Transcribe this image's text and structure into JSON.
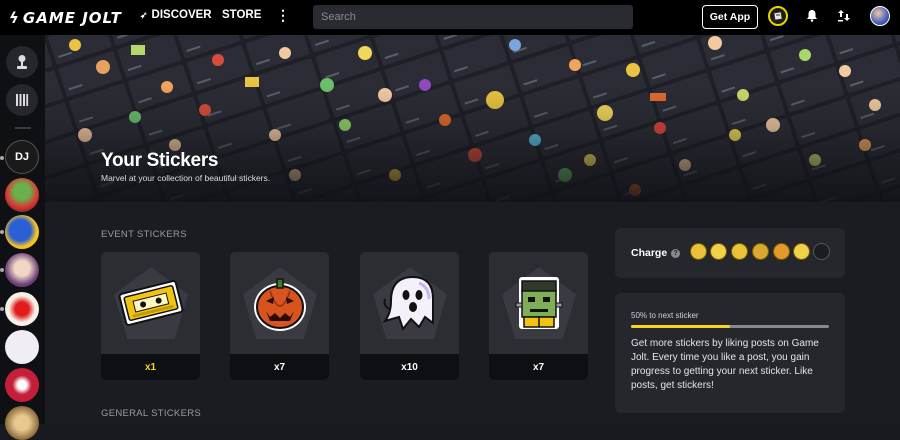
{
  "topbar": {
    "logo_text": "GAME JOLT",
    "nav_discover": "DISCOVER",
    "nav_store": "STORE",
    "more_label": "⋮",
    "search_placeholder": "Search",
    "get_app": "Get App"
  },
  "sidebar": {
    "communities": [
      "DJ",
      "",
      "",
      "",
      "",
      "",
      "",
      ""
    ]
  },
  "banner": {
    "title": "Your Stickers",
    "subtitle": "Marvel at your collection of beautiful stickers."
  },
  "event_stickers": {
    "label": "EVENT STICKERS",
    "items": [
      {
        "name": "vhs-tape",
        "count": "x1",
        "count_color": "#f7d51d"
      },
      {
        "name": "jack-o-lantern",
        "count": "x7",
        "count_color": "#ffffff"
      },
      {
        "name": "ghost",
        "count": "x10",
        "count_color": "#ffffff"
      },
      {
        "name": "frankenstein",
        "count": "x7",
        "count_color": "#ffffff"
      }
    ]
  },
  "general_stickers": {
    "label": "GENERAL STICKERS"
  },
  "charge": {
    "label": "Charge",
    "help": "?",
    "filled": 6,
    "total": 7
  },
  "progress": {
    "label": "50% to next sticker",
    "value": 0.5,
    "info": "Get more stickers by liking posts on Game Jolt. Every time you like a post, you gain progress to getting your next sticker. Like posts, get stickers!"
  },
  "colors": {
    "accent_yellow": "#f7d51d",
    "background": "#191a1f",
    "panel": "#26272d"
  }
}
